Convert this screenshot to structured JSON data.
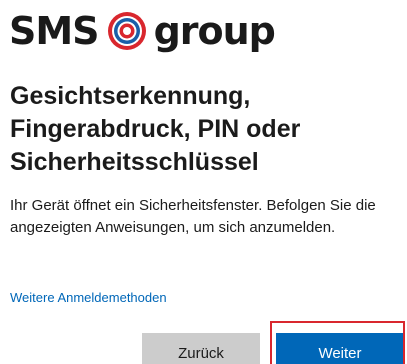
{
  "brand": {
    "name_left": "SMS",
    "name_right": "group",
    "logo_icon": "sms-group-ring-logo",
    "accent_color": "#d9272e"
  },
  "dialog": {
    "title": "Gesichtserkennung, Fingerabdruck, PIN oder Sicherheitsschlüssel",
    "description": "Ihr Gerät öffnet ein Sicherheitsfenster. Befolgen Sie die angezeigten Anweisungen, um sich anzumelden.",
    "other_methods_link": "Weitere Anmeldemethoden"
  },
  "buttons": {
    "back_label": "Zurück",
    "next_label": "Weiter",
    "primary_color": "#0067b8",
    "secondary_color": "#cccccc"
  }
}
